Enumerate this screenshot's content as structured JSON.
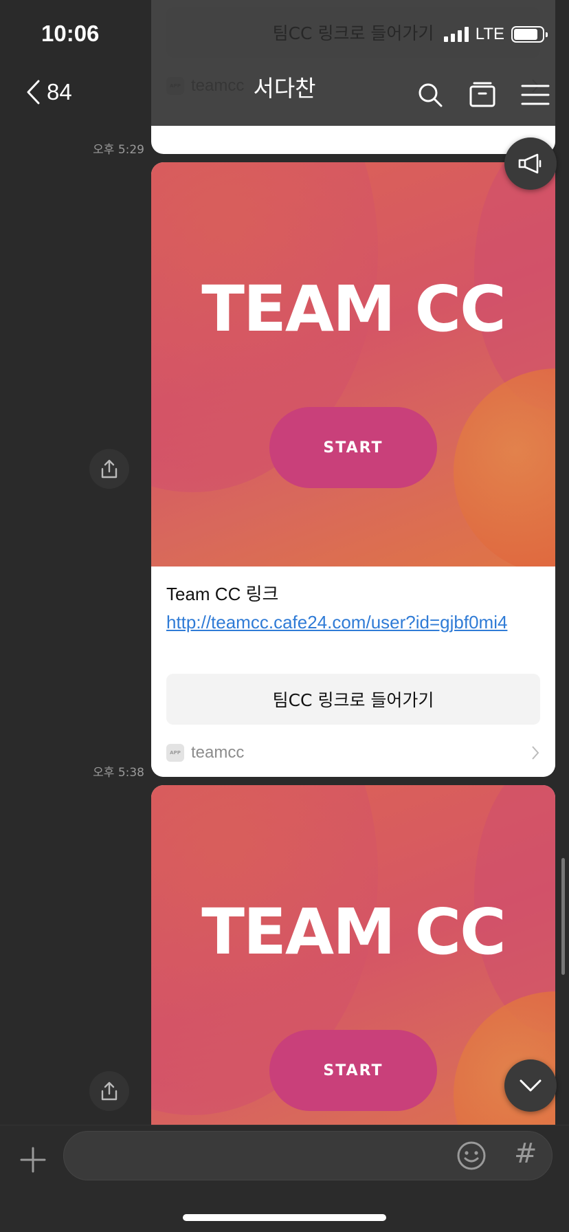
{
  "status": {
    "time": "10:06",
    "network": "LTE"
  },
  "header": {
    "back_count": "84",
    "title": "서다찬"
  },
  "messages": [
    {
      "time": "오후 5:29",
      "card": {
        "art_title": "TEAM CC",
        "art_button": "START",
        "heading": "Team CC 링크",
        "link": "http://teamcc.cafe24.com/user?id=gjbf0mi4",
        "action": "팀CC 링크로 들어가기",
        "source": "teamcc",
        "badge": "APP"
      }
    },
    {
      "time": "오후 5:38",
      "card": {
        "art_title": "TEAM CC",
        "art_button": "START",
        "heading": "Team CC 링크",
        "link": "http://teamcc.cafe24.com/user?id=gjbf0mi4",
        "action": "팀CC 링크로 들어가기",
        "source": "teamcc",
        "badge": "APP"
      }
    }
  ],
  "input": {
    "placeholder": ""
  },
  "icons": [
    "back-icon",
    "search-icon",
    "archive-icon",
    "menu-icon",
    "megaphone-icon",
    "share-icon",
    "chevron-down-icon",
    "plus-icon",
    "emoji-icon",
    "hashtag-icon",
    "chevron-right-icon"
  ]
}
